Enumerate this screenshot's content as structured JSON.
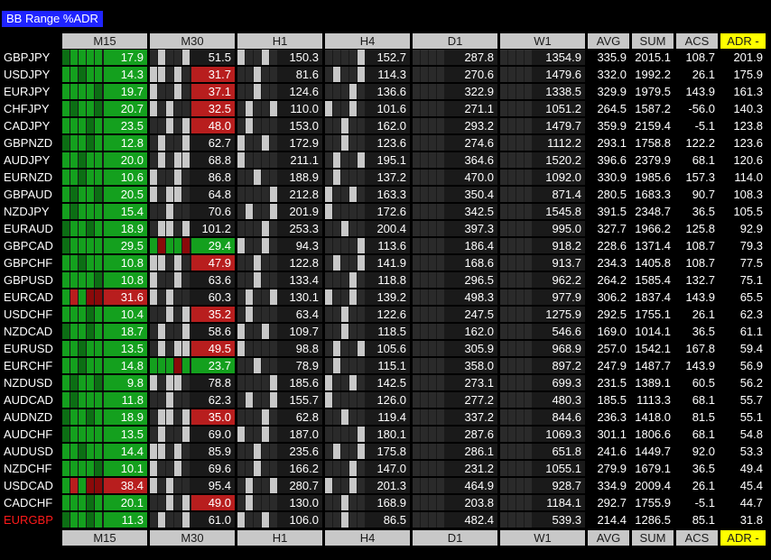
{
  "title": "BB Range %ADR",
  "columns": [
    "M15",
    "M30",
    "H1",
    "H4",
    "D1",
    "W1",
    "AVG",
    "SUM",
    "ACS",
    "ADR -"
  ],
  "highlight_symbol": "EURGBP",
  "colors": {
    "green": "#14a01e",
    "dark_green": "#0c6e14",
    "red": "#b81e1e",
    "dark_red": "#8a0a0a",
    "gray": "#c8c8c8",
    "dark": "#2a2a2a",
    "adr_header": "#ffff00",
    "title_bg": "#1f24ff"
  },
  "rows": [
    {
      "sym": "GBPJPY",
      "tf": [
        "17.9",
        "51.5",
        "150.3",
        "152.7",
        "287.8",
        "1354.9"
      ],
      "avg": "335.9",
      "sum": "2015.1",
      "acs": "108.7",
      "adr": "201.9",
      "c": [
        "g",
        "n",
        "n",
        "n",
        "n",
        "n"
      ]
    },
    {
      "sym": "USDJPY",
      "tf": [
        "14.3",
        "31.7",
        "81.6",
        "114.3",
        "270.6",
        "1479.6"
      ],
      "avg": "332.0",
      "sum": "1992.2",
      "acs": "26.1",
      "adr": "175.9",
      "c": [
        "g",
        "r",
        "n",
        "n",
        "n",
        "n"
      ]
    },
    {
      "sym": "EURJPY",
      "tf": [
        "19.7",
        "37.1",
        "124.6",
        "136.6",
        "322.9",
        "1338.5"
      ],
      "avg": "329.9",
      "sum": "1979.5",
      "acs": "143.9",
      "adr": "161.3",
      "c": [
        "g",
        "r",
        "n",
        "n",
        "n",
        "n"
      ]
    },
    {
      "sym": "CHFJPY",
      "tf": [
        "20.7",
        "32.5",
        "110.0",
        "101.6",
        "271.1",
        "1051.2"
      ],
      "avg": "264.5",
      "sum": "1587.2",
      "acs": "-56.0",
      "adr": "140.3",
      "c": [
        "g",
        "r",
        "n",
        "n",
        "n",
        "n"
      ]
    },
    {
      "sym": "CADJPY",
      "tf": [
        "23.5",
        "48.0",
        "153.0",
        "162.0",
        "293.2",
        "1479.7"
      ],
      "avg": "359.9",
      "sum": "2159.4",
      "acs": "-5.1",
      "adr": "123.8",
      "c": [
        "g",
        "r",
        "n",
        "n",
        "n",
        "n"
      ]
    },
    {
      "sym": "GBPNZD",
      "tf": [
        "12.8",
        "62.7",
        "172.9",
        "123.6",
        "274.6",
        "1112.2"
      ],
      "avg": "293.1",
      "sum": "1758.8",
      "acs": "122.2",
      "adr": "123.6",
      "c": [
        "g",
        "n",
        "n",
        "n",
        "n",
        "n"
      ]
    },
    {
      "sym": "AUDJPY",
      "tf": [
        "20.0",
        "68.8",
        "211.1",
        "195.1",
        "364.6",
        "1520.2"
      ],
      "avg": "396.6",
      "sum": "2379.9",
      "acs": "68.1",
      "adr": "120.6",
      "c": [
        "g",
        "n",
        "n",
        "n",
        "n",
        "n"
      ]
    },
    {
      "sym": "EURNZD",
      "tf": [
        "10.6",
        "86.8",
        "188.9",
        "137.2",
        "470.0",
        "1092.0"
      ],
      "avg": "330.9",
      "sum": "1985.6",
      "acs": "157.3",
      "adr": "114.0",
      "c": [
        "g",
        "n",
        "n",
        "n",
        "n",
        "n"
      ]
    },
    {
      "sym": "GBPAUD",
      "tf": [
        "20.5",
        "64.8",
        "212.8",
        "163.3",
        "350.4",
        "871.4"
      ],
      "avg": "280.5",
      "sum": "1683.3",
      "acs": "90.7",
      "adr": "108.3",
      "c": [
        "g",
        "n",
        "n",
        "n",
        "n",
        "n"
      ]
    },
    {
      "sym": "NZDJPY",
      "tf": [
        "15.4",
        "70.6",
        "201.9",
        "172.6",
        "342.5",
        "1545.8"
      ],
      "avg": "391.5",
      "sum": "2348.7",
      "acs": "36.5",
      "adr": "105.5",
      "c": [
        "g",
        "n",
        "n",
        "n",
        "n",
        "n"
      ]
    },
    {
      "sym": "EURAUD",
      "tf": [
        "18.9",
        "101.2",
        "253.3",
        "200.4",
        "397.3",
        "995.0"
      ],
      "avg": "327.7",
      "sum": "1966.2",
      "acs": "125.8",
      "adr": "92.9",
      "c": [
        "g",
        "n",
        "n",
        "n",
        "n",
        "n"
      ]
    },
    {
      "sym": "GBPCAD",
      "tf": [
        "29.5",
        "29.4",
        "94.3",
        "113.6",
        "186.4",
        "918.2"
      ],
      "avg": "228.6",
      "sum": "1371.4",
      "acs": "108.7",
      "adr": "79.3",
      "c": [
        "g",
        "g",
        "n",
        "n",
        "n",
        "n"
      ]
    },
    {
      "sym": "GBPCHF",
      "tf": [
        "10.8",
        "47.9",
        "122.8",
        "141.9",
        "168.6",
        "913.7"
      ],
      "avg": "234.3",
      "sum": "1405.8",
      "acs": "108.7",
      "adr": "77.5",
      "c": [
        "g",
        "r",
        "n",
        "n",
        "n",
        "n"
      ]
    },
    {
      "sym": "GBPUSD",
      "tf": [
        "10.8",
        "63.6",
        "133.4",
        "118.8",
        "296.5",
        "962.2"
      ],
      "avg": "264.2",
      "sum": "1585.4",
      "acs": "132.7",
      "adr": "75.1",
      "c": [
        "g",
        "n",
        "n",
        "n",
        "n",
        "n"
      ]
    },
    {
      "sym": "EURCAD",
      "tf": [
        "31.6",
        "60.3",
        "130.1",
        "139.2",
        "498.3",
        "977.9"
      ],
      "avg": "306.2",
      "sum": "1837.4",
      "acs": "143.9",
      "adr": "65.5",
      "c": [
        "r",
        "n",
        "n",
        "n",
        "n",
        "n"
      ]
    },
    {
      "sym": "USDCHF",
      "tf": [
        "10.4",
        "35.2",
        "63.4",
        "122.6",
        "247.5",
        "1275.9"
      ],
      "avg": "292.5",
      "sum": "1755.1",
      "acs": "26.1",
      "adr": "62.3",
      "c": [
        "g",
        "r",
        "n",
        "n",
        "n",
        "n"
      ]
    },
    {
      "sym": "NZDCAD",
      "tf": [
        "18.7",
        "58.6",
        "109.7",
        "118.5",
        "162.0",
        "546.6"
      ],
      "avg": "169.0",
      "sum": "1014.1",
      "acs": "36.5",
      "adr": "61.1",
      "c": [
        "g",
        "n",
        "n",
        "n",
        "n",
        "n"
      ]
    },
    {
      "sym": "EURUSD",
      "tf": [
        "13.5",
        "49.5",
        "98.8",
        "105.6",
        "305.9",
        "968.9"
      ],
      "avg": "257.0",
      "sum": "1542.1",
      "acs": "167.8",
      "adr": "59.4",
      "c": [
        "g",
        "r",
        "n",
        "n",
        "n",
        "n"
      ]
    },
    {
      "sym": "EURCHF",
      "tf": [
        "14.8",
        "23.7",
        "78.9",
        "115.1",
        "358.0",
        "897.2"
      ],
      "avg": "247.9",
      "sum": "1487.7",
      "acs": "143.9",
      "adr": "56.9",
      "c": [
        "g",
        "g",
        "n",
        "n",
        "n",
        "n"
      ]
    },
    {
      "sym": "NZDUSD",
      "tf": [
        "9.8",
        "78.8",
        "185.6",
        "142.5",
        "273.1",
        "699.3"
      ],
      "avg": "231.5",
      "sum": "1389.1",
      "acs": "60.5",
      "adr": "56.2",
      "c": [
        "g",
        "n",
        "n",
        "n",
        "n",
        "n"
      ]
    },
    {
      "sym": "AUDCAD",
      "tf": [
        "11.8",
        "62.3",
        "155.7",
        "126.0",
        "277.2",
        "480.3"
      ],
      "avg": "185.5",
      "sum": "1113.3",
      "acs": "68.1",
      "adr": "55.7",
      "c": [
        "g",
        "n",
        "n",
        "n",
        "n",
        "n"
      ]
    },
    {
      "sym": "AUDNZD",
      "tf": [
        "18.9",
        "35.0",
        "62.8",
        "119.4",
        "337.2",
        "844.6"
      ],
      "avg": "236.3",
      "sum": "1418.0",
      "acs": "81.5",
      "adr": "55.1",
      "c": [
        "g",
        "r",
        "n",
        "n",
        "n",
        "n"
      ]
    },
    {
      "sym": "AUDCHF",
      "tf": [
        "13.5",
        "69.0",
        "187.0",
        "180.1",
        "287.6",
        "1069.3"
      ],
      "avg": "301.1",
      "sum": "1806.6",
      "acs": "68.1",
      "adr": "54.8",
      "c": [
        "g",
        "n",
        "n",
        "n",
        "n",
        "n"
      ]
    },
    {
      "sym": "AUDUSD",
      "tf": [
        "14.4",
        "85.9",
        "235.6",
        "175.8",
        "286.1",
        "651.8"
      ],
      "avg": "241.6",
      "sum": "1449.7",
      "acs": "92.0",
      "adr": "53.3",
      "c": [
        "g",
        "n",
        "n",
        "n",
        "n",
        "n"
      ]
    },
    {
      "sym": "NZDCHF",
      "tf": [
        "10.1",
        "69.6",
        "166.2",
        "147.0",
        "231.2",
        "1055.1"
      ],
      "avg": "279.9",
      "sum": "1679.1",
      "acs": "36.5",
      "adr": "49.4",
      "c": [
        "g",
        "n",
        "n",
        "n",
        "n",
        "n"
      ]
    },
    {
      "sym": "USDCAD",
      "tf": [
        "38.4",
        "95.4",
        "280.7",
        "201.3",
        "464.9",
        "928.7"
      ],
      "avg": "334.9",
      "sum": "2009.4",
      "acs": "26.1",
      "adr": "45.4",
      "c": [
        "r",
        "n",
        "n",
        "n",
        "n",
        "n"
      ]
    },
    {
      "sym": "CADCHF",
      "tf": [
        "20.1",
        "49.0",
        "130.0",
        "168.9",
        "203.8",
        "1184.1"
      ],
      "avg": "292.7",
      "sum": "1755.9",
      "acs": "-5.1",
      "adr": "44.7",
      "c": [
        "g",
        "r",
        "n",
        "n",
        "n",
        "n"
      ]
    },
    {
      "sym": "EURGBP",
      "tf": [
        "11.3",
        "61.0",
        "106.0",
        "86.5",
        "482.4",
        "539.3"
      ],
      "avg": "214.4",
      "sum": "1286.5",
      "acs": "85.1",
      "adr": "31.8",
      "c": [
        "g",
        "n",
        "n",
        "n",
        "n",
        "n"
      ]
    }
  ]
}
